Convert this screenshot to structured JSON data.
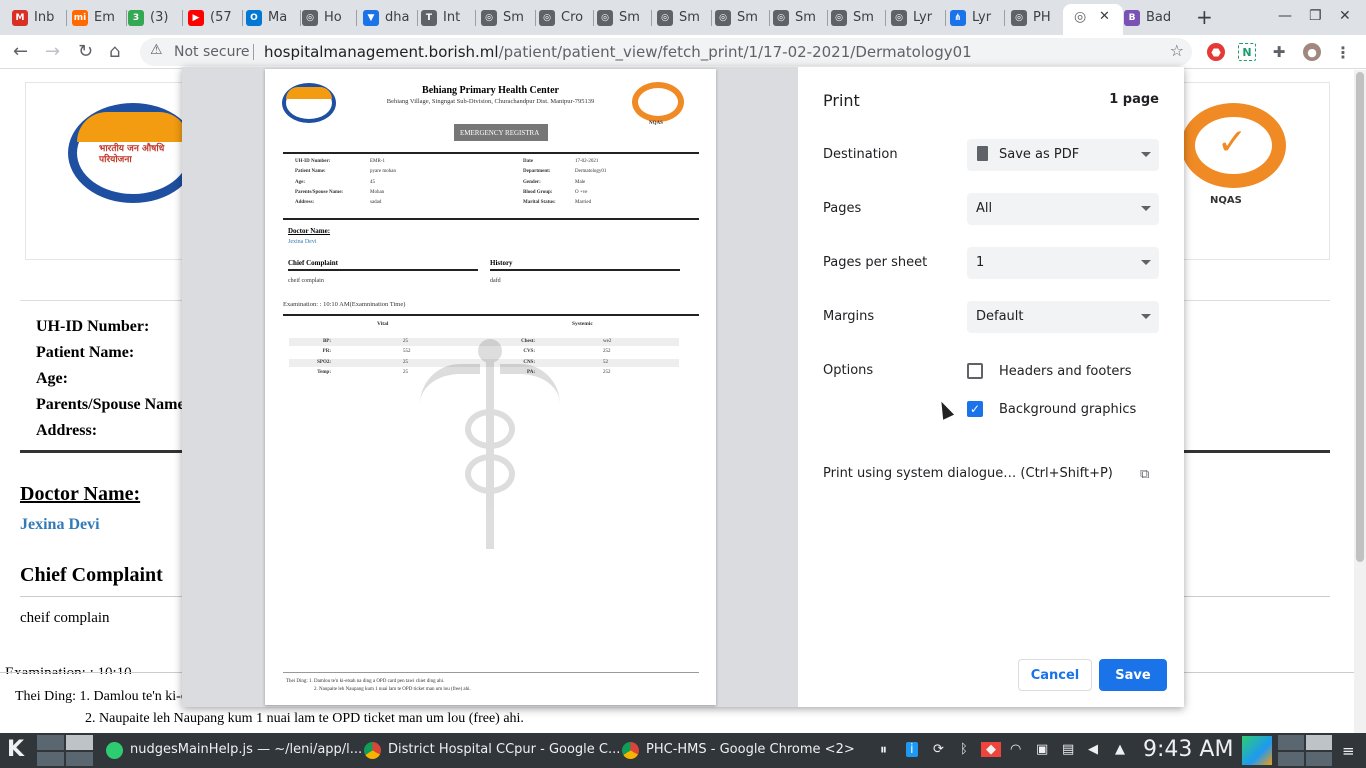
{
  "browser": {
    "tabs": [
      {
        "label": "Inb",
        "color": "#d93025",
        "glyph": "M"
      },
      {
        "label": "Em",
        "color": "#ff6900",
        "glyph": "mi"
      },
      {
        "label": "(3)",
        "color": "#34a853",
        "glyph": "3"
      },
      {
        "label": "(57",
        "color": "#ff0000",
        "glyph": "▶"
      },
      {
        "label": "Ma",
        "color": "#0078d4",
        "glyph": "O"
      },
      {
        "label": "Ho",
        "color": "#5f6368",
        "glyph": "◎"
      },
      {
        "label": "dha",
        "color": "#1a73e8",
        "glyph": "▼"
      },
      {
        "label": "Int",
        "color": "#5f6368",
        "glyph": "T"
      },
      {
        "label": "Sm",
        "color": "#5f6368",
        "glyph": "◎"
      },
      {
        "label": "Cro",
        "color": "#5f6368",
        "glyph": "◎"
      },
      {
        "label": "Sm",
        "color": "#5f6368",
        "glyph": "◎"
      },
      {
        "label": "Sm",
        "color": "#5f6368",
        "glyph": "◎"
      },
      {
        "label": "Sm",
        "color": "#5f6368",
        "glyph": "◎"
      },
      {
        "label": "Sm",
        "color": "#5f6368",
        "glyph": "◎"
      },
      {
        "label": "Sm",
        "color": "#5f6368",
        "glyph": "◎"
      },
      {
        "label": "Lyr",
        "color": "#5f6368",
        "glyph": "◎"
      },
      {
        "label": "Lyr",
        "color": "#1a73e8",
        "glyph": "⋔"
      },
      {
        "label": "PH",
        "color": "#5f6368",
        "glyph": "◎"
      },
      {
        "label": "",
        "color": "#5f6368",
        "glyph": "◎"
      },
      {
        "label": "Bad",
        "color": "#7952b3",
        "glyph": "B"
      }
    ],
    "new_tab": "+",
    "url_security": "Not secure",
    "url_host": "hospitalmanagement.borish.ml",
    "url_path": "/patient/patient_view/fetch_print/1/17-02-2021/Dermatology01"
  },
  "background": {
    "labels": [
      "UH-ID Number:",
      "Patient Name:",
      "Age:",
      "Parents/Spouse Name",
      "Address:"
    ],
    "doctor_heading": "Doctor Name:",
    "doctor_name": "Jexina Devi",
    "chief_heading": "Chief Complaint",
    "chief_text": "cheif complain",
    "exam_partial": "Examination: : 10:10",
    "footer_1": "Thei Ding: 1. Damlou te'n ki-e",
    "footer_2": "2. Naupaite leh Naupang kum 1 nuai lam te OPD ticket man um lou (free) ahi.",
    "nqas": "NQAS",
    "jan_aushadhi": "भारतीय जन औषधि परियोजना"
  },
  "preview": {
    "title": "Behiang Primary Health Center",
    "address": "Behiang Village, Singngat Sub-Division, Churachandpur Dist. Manipur-795139",
    "nqas": "NQAS",
    "banner": "EMERGENCY REGISTRA",
    "left_fields": [
      {
        "k": "UH-ID Number:",
        "v": "EMR-1"
      },
      {
        "k": "Patient Name:",
        "v": "pyare mohan"
      },
      {
        "k": "Age:",
        "v": "45"
      },
      {
        "k": "Parents/Spouse Name:",
        "v": "Mohan"
      },
      {
        "k": "Address:",
        "v": "sadad"
      }
    ],
    "right_fields": [
      {
        "k": "Date",
        "v": "17-02-2021"
      },
      {
        "k": "Department:",
        "v": "Dermatology01"
      },
      {
        "k": "Gender:",
        "v": "Male"
      },
      {
        "k": "Blood Group:",
        "v": "O +ve"
      },
      {
        "k": "Marital Status:",
        "v": "Married"
      }
    ],
    "doctor_heading": "Doctor Name:",
    "doctor_name": "Jexina Devi",
    "chief_heading": "Chief Complaint",
    "history_heading": "History",
    "chief_text": "cheif complain",
    "history_text": "dafd",
    "exam": "Examination: : 10:10 AM(Examnination Time)",
    "vital_heading": "Vital",
    "systemic_heading": "Systemic",
    "vitals": [
      {
        "k": "BP:",
        "v": "25",
        "sk": "Chest:",
        "sv": "we2"
      },
      {
        "k": "PR:",
        "v": "552",
        "sk": "CVS:",
        "sv": "252"
      },
      {
        "k": "SPO2:",
        "v": "25",
        "sk": "CNS:",
        "sv": "52"
      },
      {
        "k": "Temp:",
        "v": "25",
        "sk": "PA:",
        "sv": "252"
      }
    ],
    "footer_1": "Thei Ding: 1. Damlou te'n ki-etsah na ding a OPD card pen tawi chiet ding ahi.",
    "footer_2": "2. Naupaite leh Naupang kum 1 nuai lam te OPD ticket man um lou (free) ahi."
  },
  "print": {
    "title": "Print",
    "page_count": "1 page",
    "destination_label": "Destination",
    "destination_value": "Save as PDF",
    "pages_label": "Pages",
    "pages_value": "All",
    "pps_label": "Pages per sheet",
    "pps_value": "1",
    "margins_label": "Margins",
    "margins_value": "Default",
    "options_label": "Options",
    "headers_footers": "Headers and footers",
    "headers_footers_checked": false,
    "background_graphics": "Background graphics",
    "background_graphics_checked": true,
    "system_dialog": "Print using system dialogue… (Ctrl+Shift+P)",
    "cancel": "Cancel",
    "save": "Save",
    "accent": "#1a73e8"
  },
  "taskbar": {
    "items": [
      {
        "label": "nudgesMainHelp.js — ~/leni/app/l..."
      },
      {
        "label": "District Hospital CCpur - Google C..."
      },
      {
        "label": "PHC-HMS - Google Chrome <2>"
      }
    ],
    "clock": "9:43 AM"
  }
}
